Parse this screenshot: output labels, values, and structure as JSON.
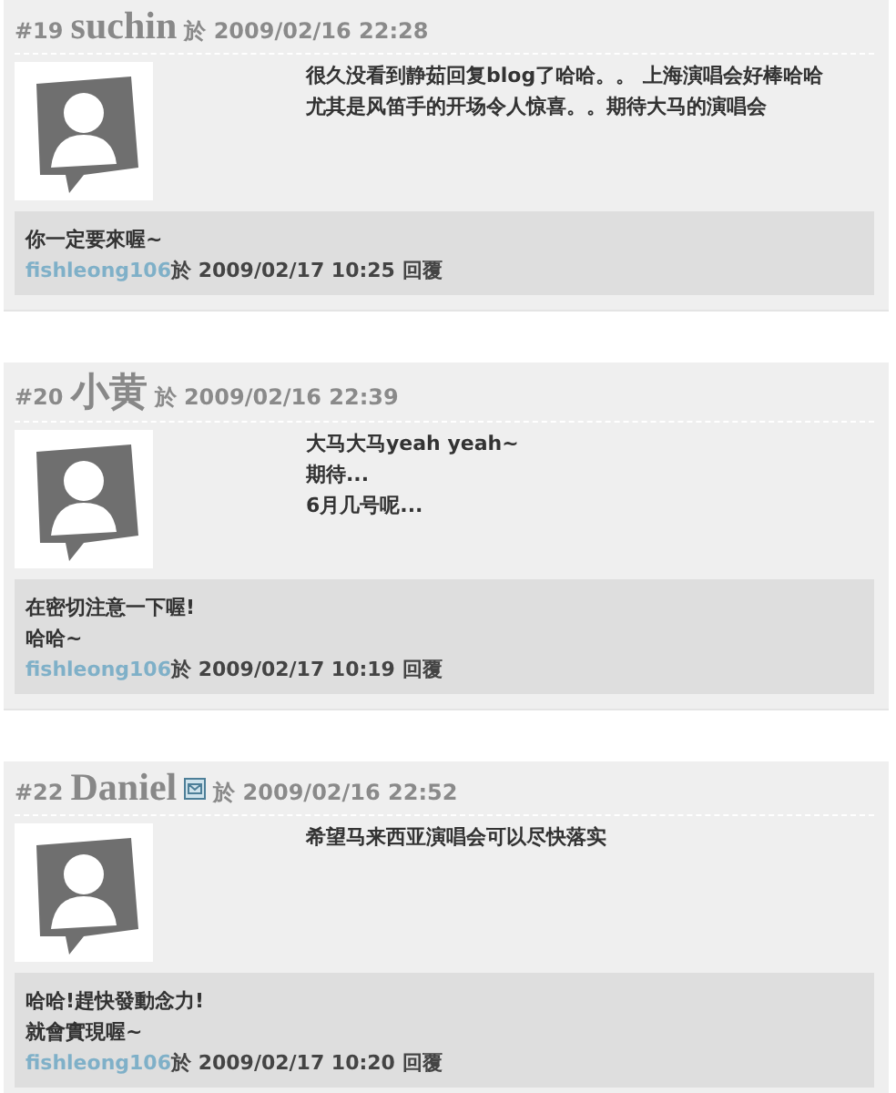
{
  "comments": [
    {
      "number": "#19",
      "author": "suchin",
      "email_icon": false,
      "date": "於 2009/02/16 22:28",
      "content": [
        "很久没看到静茹回复blog了哈哈。。 上海演唱会好棒哈哈",
        "尤其是风笛手的开场令人惊喜。。期待大马的演唱会"
      ],
      "reply": {
        "lines": [
          "你一定要來喔~"
        ],
        "author": "fishleong106",
        "time": "於 2009/02/17 10:25",
        "action": "回覆"
      }
    },
    {
      "number": "#20",
      "author": "小黄",
      "email_icon": false,
      "date": "於 2009/02/16 22:39",
      "content": [
        "大马大马yeah yeah~",
        "期待...",
        "6月几号呢..."
      ],
      "reply": {
        "lines": [
          "在密切注意一下喔!",
          "哈哈~"
        ],
        "author": "fishleong106",
        "time": "於 2009/02/17 10:19",
        "action": "回覆"
      }
    },
    {
      "number": "#22",
      "author": "Daniel",
      "email_icon": true,
      "date": "於 2009/02/16 22:52",
      "content": [
        "希望马来西亚演唱会可以尽快落实"
      ],
      "reply": {
        "lines": [
          "哈哈!趕快發動念力!",
          "就會實現喔~"
        ],
        "author": "fishleong106",
        "time": "於 2009/02/17 10:20",
        "action": "回覆"
      }
    }
  ]
}
